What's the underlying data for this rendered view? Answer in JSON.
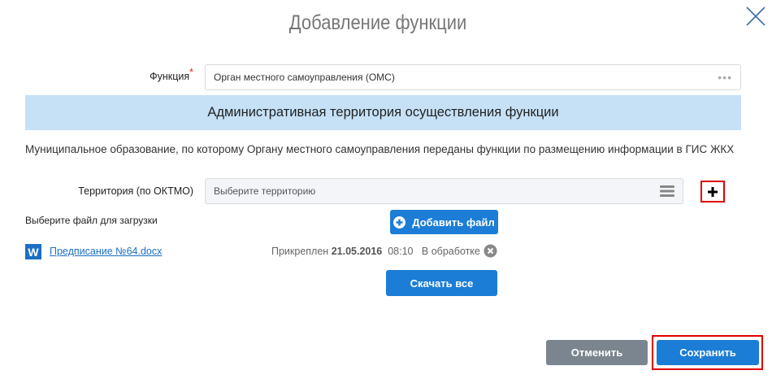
{
  "dialog": {
    "title": "Добавление функции"
  },
  "function": {
    "label": "Функция",
    "required_mark": "*",
    "value": "Орган местного самоуправления (ОМС)"
  },
  "section": {
    "title": "Административная территория осуществления функции",
    "description": "Муниципальное образование, по которому Органу местного самоуправления переданы функции по размещению информации в ГИС ЖКХ"
  },
  "territory": {
    "label": "Территория (по ОКТМО)",
    "placeholder": "Выберите территорию"
  },
  "upload": {
    "label": "Выберите файл для загрузки",
    "add_button": "Добавить файл"
  },
  "file": {
    "name": "Предписание №64.docx",
    "attached_label": "Прикреплен",
    "date": "21.05.2016",
    "time": "08:10",
    "status": "В обработке"
  },
  "download_all": "Скачать все",
  "footer": {
    "cancel": "Отменить",
    "save": "Сохранить"
  },
  "colors": {
    "accent": "#1b7dd6",
    "highlight": "#e00000",
    "banner": "#c6e1f6"
  }
}
